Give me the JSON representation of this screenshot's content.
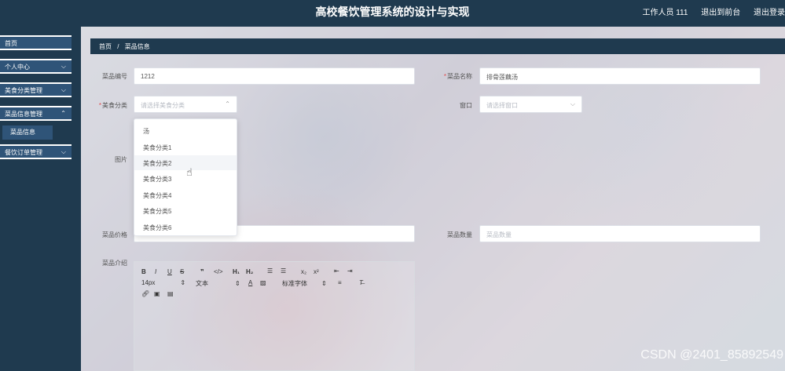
{
  "header": {
    "title": "高校餐饮管理系统的设计与实现",
    "user": "工作人员 111",
    "backend_link": "退出到前台",
    "logout_link": "退出登录"
  },
  "sidebar": {
    "items": [
      {
        "label": "首页"
      },
      {
        "label": "个人中心"
      },
      {
        "label": "美食分类管理"
      },
      {
        "label": "菜品信息管理"
      },
      {
        "label": "餐饮订单管理"
      }
    ],
    "sub_active": "菜品信息"
  },
  "breadcrumb": {
    "home": "首页",
    "current": "菜品信息"
  },
  "form": {
    "dish_no_label": "菜品编号",
    "dish_no_value": "1212",
    "dish_name_label": "菜品名称",
    "dish_name_value": "排骨莲藕汤",
    "category_label": "美食分类",
    "category_placeholder": "请选择美食分类",
    "window_label": "窗口",
    "window_placeholder": "请选择窗口",
    "image_label": "图片",
    "price_label": "菜品价格",
    "quantity_label": "菜品数量",
    "quantity_placeholder": "菜品数量",
    "intro_label": "菜品介绍"
  },
  "dropdown": {
    "options": [
      "汤",
      "美食分类1",
      "美食分类2",
      "美食分类3",
      "美食分类4",
      "美食分类5",
      "美食分类6"
    ],
    "hovered": "美食分类2"
  },
  "editor": {
    "font_size": "14px",
    "text_type": "文本",
    "font_family": "标准字体"
  },
  "watermark": "CSDN @2401_85892549"
}
